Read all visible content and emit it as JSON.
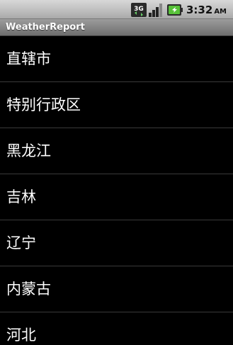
{
  "status_bar": {
    "network_icon": "3g-data-icon",
    "network_label": "3G",
    "signal_icon": "signal-strength-icon",
    "battery_icon": "battery-charging-icon",
    "time": "3:32",
    "ampm": "AM"
  },
  "app": {
    "title": "WeatherReport"
  },
  "provinces": [
    {
      "label": "直辖市"
    },
    {
      "label": "特别行政区"
    },
    {
      "label": "黑龙江"
    },
    {
      "label": "吉林"
    },
    {
      "label": "辽宁"
    },
    {
      "label": "内蒙古"
    },
    {
      "label": "河北"
    }
  ]
}
